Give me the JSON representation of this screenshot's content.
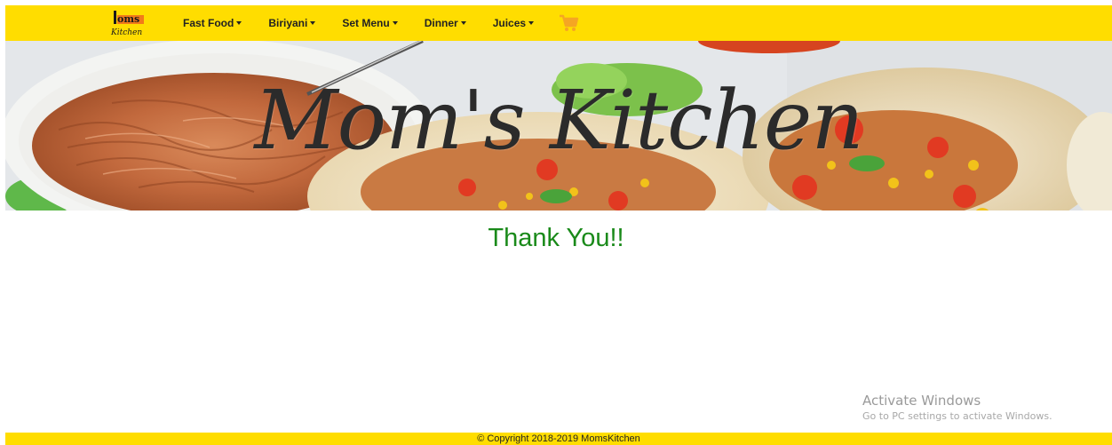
{
  "brand": {
    "logo_top": "oms",
    "logo_bottom": "Kitchen",
    "hero_title": "Mom's Kitchen"
  },
  "nav": {
    "items": [
      {
        "label": "Fast Food"
      },
      {
        "label": "Biriyani"
      },
      {
        "label": "Set Menu"
      },
      {
        "label": "Dinner"
      },
      {
        "label": "Juices"
      }
    ],
    "cart_icon": "shopping-cart-icon"
  },
  "main": {
    "message": "Thank You!!"
  },
  "watermark": {
    "title": "Activate Windows",
    "subtitle": "Go to PC settings to activate Windows."
  },
  "footer": {
    "copyright": "© Copyright 2018-2019 MomsKitchen"
  },
  "colors": {
    "navbar_bg": "#ffdd00",
    "message_color": "#1a8a1a",
    "cart_color": "#f5a623"
  }
}
